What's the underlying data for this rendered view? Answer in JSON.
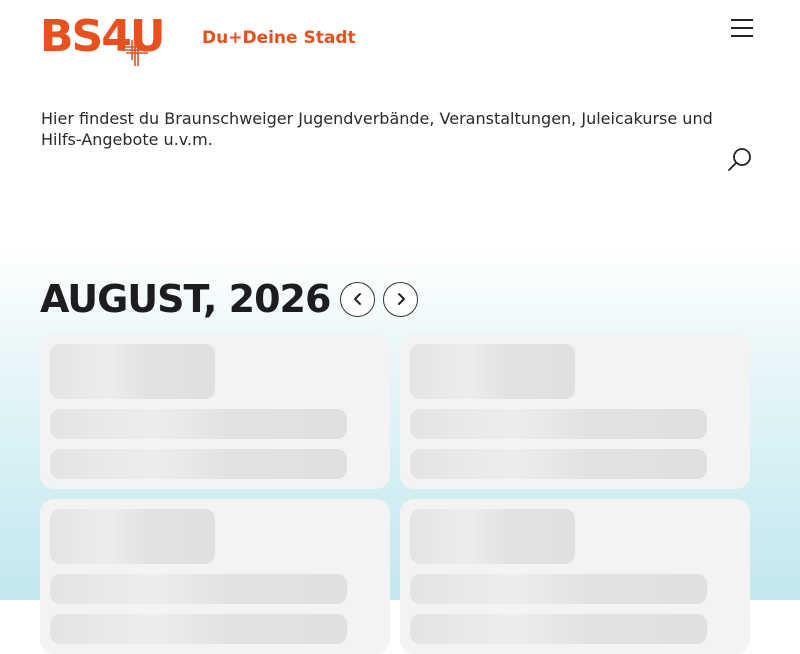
{
  "header": {
    "logo_text": "BS4U",
    "tagline": "Du+Deine Stadt",
    "menu_icon": "hamburger-menu-icon"
  },
  "intro": {
    "text": "Hier findest du Braunschweiger Jugendverbände, Veranstaltungen, Juleicakurse und Hilfs-Angebote u.v.m."
  },
  "search": {
    "icon": "search-icon"
  },
  "calendar": {
    "month_title": "AUGUST, 2026",
    "prev_icon": "chevron-left-icon",
    "next_icon": "chevron-right-icon"
  },
  "colors": {
    "brand": "#e8501e",
    "text": "#1d1d1f",
    "card_bg": "#f3f3f3",
    "skeleton": "#e4e4e4"
  }
}
